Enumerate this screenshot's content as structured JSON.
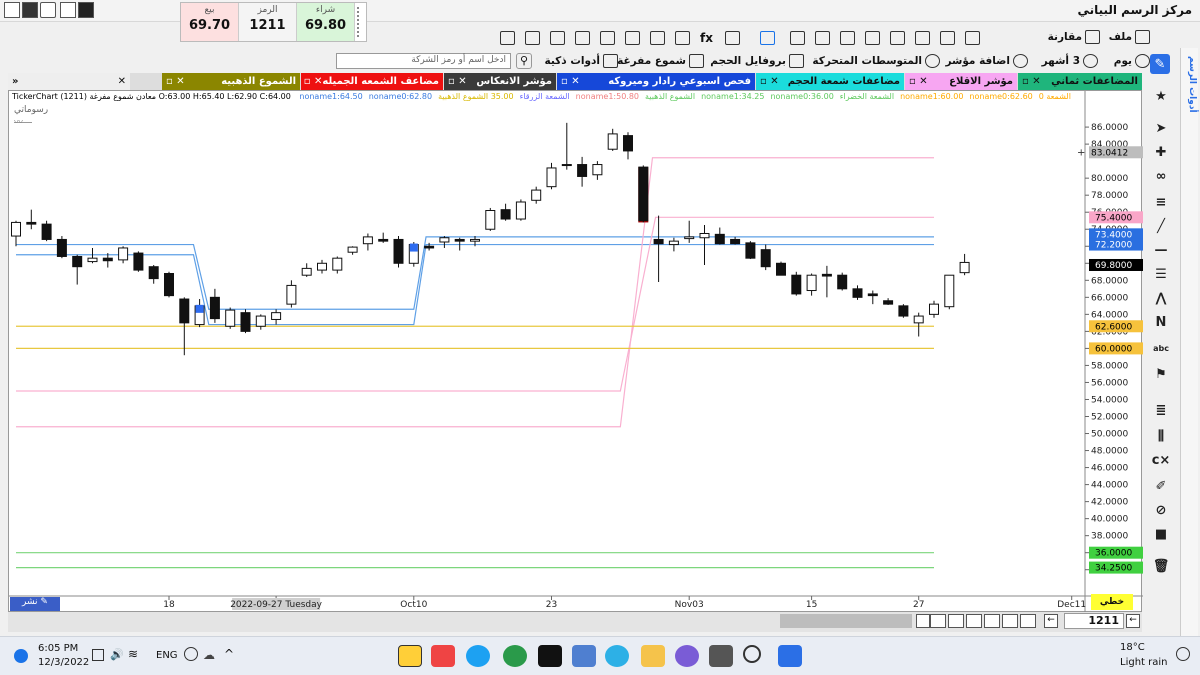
{
  "app": {
    "title": "مركز الرسم البياني"
  },
  "quote": {
    "sell_label": "بيع",
    "sell_value": "69.70",
    "symbol_label": "الرمز",
    "symbol_value": "1211",
    "buy_label": "شراء",
    "buy_value": "69.80"
  },
  "toolbar1": {
    "file": "ملف",
    "compare": "مقارنة"
  },
  "toolbar2": {
    "day": "يوم",
    "months": "3 أشهر",
    "add_indicator": "اضافة مؤشر",
    "moving_avgs": "المتوسطات المتحركة",
    "volume_profile": "بروفايل الحجم",
    "hollow_candles": "شموع مفرغة",
    "smart_tools": "أدوات ذكية",
    "search_placeholder": "ادخل اسم أو رمز الشركة"
  },
  "tabs": [
    {
      "label": "المضاعفات ثماني",
      "color": "#1fb57c"
    },
    {
      "label": "مؤشر الاقلاع",
      "color": "#f7a6f2"
    },
    {
      "label": "مضاعفات شمعة الحجم",
      "color": "#1bdcdc"
    },
    {
      "label": "فحص اسبوعي رادار وميروكه",
      "color": "#1648d9"
    },
    {
      "label": "مؤشر الانعكاس",
      "color": "#3a3a3a"
    },
    {
      "label": "مضاعف الشمعه الجميله",
      "color": "#e11"
    },
    {
      "label": "الشموع الذهبيه",
      "color": "#8b8600"
    }
  ],
  "legend": {
    "ohlc": "TickerChart (1211) معادن شموع مفرغة O:63.00 H:65.40 L:62.90 C:64.00",
    "items": [
      {
        "text": "noname1:64.50",
        "color": "#3a7be0"
      },
      {
        "text": "noname0:62.80",
        "color": "#3a7be0"
      },
      {
        "text": "الشمعة الزرقاء",
        "color": "#6b6bff"
      },
      {
        "text": "35.00 الشموع الذهبية",
        "color": "#d8b800"
      },
      {
        "text": "noname1:50.80",
        "color": "#f08080"
      },
      {
        "text": "الشموع الذهبية",
        "color": "#5ec95e"
      },
      {
        "text": "noname1:34.25",
        "color": "#5ec95e"
      },
      {
        "text": "noname0:36.00",
        "color": "#5ec95e"
      },
      {
        "text": "الشمعة الخضراء",
        "color": "#5ec95e"
      },
      {
        "text": "noname1:60.00",
        "color": "#ffaa00"
      },
      {
        "text": "noname0:62.60",
        "color": "#ffaa00"
      },
      {
        "text": "الشمعة 0",
        "color": "#ffaa00"
      }
    ]
  },
  "drawings_label": "رسوماتي",
  "draw_button": "نشر",
  "goto_button": "خطي",
  "symbol_box": "1211",
  "side_panel_label": "أدوات الرسم",
  "price_axis": {
    "ticks": [
      "86.0000",
      "84.0000",
      "80.0000",
      "78.0000",
      "76.0000",
      "74.0000",
      "72.0000",
      "70.0000",
      "68.0000",
      "66.0000",
      "64.0000",
      "62.0000",
      "60.0000",
      "58.0000",
      "56.0000",
      "54.0000",
      "52.0000",
      "50.0000",
      "48.0000",
      "46.0000",
      "44.0000",
      "42.0000",
      "40.0000",
      "38.0000",
      "36.0000",
      "34.0000"
    ],
    "current": "83.0412",
    "badges": [
      {
        "label": "75.4000",
        "value": 75.4,
        "bg": "#f9a6c8",
        "fg": "#000"
      },
      {
        "label": "73.4000",
        "value": 73.4,
        "bg": "#2a6fe0",
        "fg": "#fff"
      },
      {
        "label": "72.2000",
        "value": 72.2,
        "bg": "#2a6fe0",
        "fg": "#fff"
      },
      {
        "label": "69.8000",
        "value": 69.8,
        "bg": "#000",
        "fg": "#fff"
      },
      {
        "label": "62.6000",
        "value": 62.6,
        "bg": "#f6c23c",
        "fg": "#000"
      },
      {
        "label": "60.0000",
        "value": 60.0,
        "bg": "#f6c23c",
        "fg": "#000"
      },
      {
        "label": "36.0000",
        "value": 36.0,
        "bg": "#40d040",
        "fg": "#000"
      },
      {
        "label": "34.2500",
        "value": 34.25,
        "bg": "#40d040",
        "fg": "#000"
      }
    ]
  },
  "time_axis": {
    "ticks": [
      {
        "label": "18",
        "index": 10
      },
      {
        "label": "2022-09-27 Tuesday",
        "index": 17,
        "highlight": true
      },
      {
        "label": "Oct10",
        "index": 26
      },
      {
        "label": "23",
        "index": 35
      },
      {
        "label": "Nov03",
        "index": 44
      },
      {
        "label": "15",
        "index": 52
      },
      {
        "label": "27",
        "index": 59
      },
      {
        "label": "Dec11",
        "index": 69
      }
    ]
  },
  "chart_data": {
    "type": "candlestick",
    "ylim": [
      31.5,
      89.3
    ],
    "candles": [
      {
        "o": 73.2,
        "h": 75.0,
        "l": 72.0,
        "c": 74.8
      },
      {
        "o": 74.8,
        "h": 76.3,
        "l": 74.0,
        "c": 74.6
      },
      {
        "o": 74.6,
        "h": 75.0,
        "l": 72.6,
        "c": 72.8
      },
      {
        "o": 72.8,
        "h": 73.2,
        "l": 70.6,
        "c": 70.8
      },
      {
        "o": 70.8,
        "h": 71.0,
        "l": 67.5,
        "c": 69.6
      },
      {
        "o": 70.2,
        "h": 71.8,
        "l": 70.0,
        "c": 70.6
      },
      {
        "o": 70.6,
        "h": 71.2,
        "l": 69.5,
        "c": 70.3
      },
      {
        "o": 70.4,
        "h": 72.0,
        "l": 70.0,
        "c": 71.8
      },
      {
        "o": 71.2,
        "h": 71.4,
        "l": 69.0,
        "c": 69.2
      },
      {
        "o": 69.6,
        "h": 69.8,
        "l": 67.6,
        "c": 68.2
      },
      {
        "o": 68.8,
        "h": 69.0,
        "l": 66.0,
        "c": 66.2
      },
      {
        "o": 65.8,
        "h": 66.0,
        "l": 59.2,
        "c": 63.0
      },
      {
        "o": 62.8,
        "h": 65.8,
        "l": 62.5,
        "c": 65.0
      },
      {
        "o": 66.0,
        "h": 67.0,
        "l": 63.0,
        "c": 63.5
      },
      {
        "o": 62.6,
        "h": 64.8,
        "l": 62.3,
        "c": 64.5
      },
      {
        "o": 64.2,
        "h": 64.6,
        "l": 61.8,
        "c": 62.0
      },
      {
        "o": 62.6,
        "h": 64.0,
        "l": 62.2,
        "c": 63.8
      },
      {
        "o": 63.4,
        "h": 64.6,
        "l": 62.8,
        "c": 64.2
      },
      {
        "o": 65.2,
        "h": 68.0,
        "l": 64.8,
        "c": 67.4
      },
      {
        "o": 68.6,
        "h": 70.0,
        "l": 68.4,
        "c": 69.4
      },
      {
        "o": 69.2,
        "h": 70.4,
        "l": 68.8,
        "c": 70.0
      },
      {
        "o": 69.2,
        "h": 70.8,
        "l": 68.8,
        "c": 70.6
      },
      {
        "o": 71.3,
        "h": 72.0,
        "l": 71.0,
        "c": 71.9
      },
      {
        "o": 72.3,
        "h": 73.5,
        "l": 71.5,
        "c": 73.1
      },
      {
        "o": 72.8,
        "h": 73.6,
        "l": 72.4,
        "c": 72.6
      },
      {
        "o": 72.8,
        "h": 73.2,
        "l": 69.5,
        "c": 70.0
      },
      {
        "o": 70.0,
        "h": 72.5,
        "l": 69.6,
        "c": 72.2
      },
      {
        "o": 72.0,
        "h": 72.4,
        "l": 71.5,
        "c": 71.8
      },
      {
        "o": 72.5,
        "h": 73.2,
        "l": 71.8,
        "c": 73.0
      },
      {
        "o": 72.8,
        "h": 73.0,
        "l": 71.5,
        "c": 72.6
      },
      {
        "o": 72.6,
        "h": 73.2,
        "l": 72.0,
        "c": 72.8
      },
      {
        "o": 74.0,
        "h": 76.5,
        "l": 73.8,
        "c": 76.2
      },
      {
        "o": 76.3,
        "h": 77.0,
        "l": 75.0,
        "c": 75.2
      },
      {
        "o": 75.2,
        "h": 77.5,
        "l": 75.0,
        "c": 77.2
      },
      {
        "o": 77.4,
        "h": 79.0,
        "l": 77.0,
        "c": 78.6
      },
      {
        "o": 79.0,
        "h": 81.8,
        "l": 78.7,
        "c": 81.2
      },
      {
        "o": 81.5,
        "h": 86.5,
        "l": 81.0,
        "c": 81.6
      },
      {
        "o": 81.6,
        "h": 82.5,
        "l": 79.0,
        "c": 80.2
      },
      {
        "o": 80.4,
        "h": 82.0,
        "l": 79.8,
        "c": 81.6
      },
      {
        "o": 83.4,
        "h": 85.8,
        "l": 83.2,
        "c": 85.2
      },
      {
        "o": 85.0,
        "h": 85.4,
        "l": 82.2,
        "c": 83.2
      },
      {
        "o": 81.3,
        "h": 81.5,
        "l": 74.8,
        "c": 75.0
      },
      {
        "o": 72.8,
        "h": 75.6,
        "l": 67.8,
        "c": 72.3
      },
      {
        "o": 72.2,
        "h": 73.0,
        "l": 71.4,
        "c": 72.6
      },
      {
        "o": 72.9,
        "h": 75.0,
        "l": 72.4,
        "c": 73.1
      },
      {
        "o": 73.0,
        "h": 74.5,
        "l": 69.8,
        "c": 73.5
      },
      {
        "o": 73.4,
        "h": 74.2,
        "l": 72.2,
        "c": 72.3
      },
      {
        "o": 72.8,
        "h": 73.1,
        "l": 72.2,
        "c": 72.3
      },
      {
        "o": 72.4,
        "h": 72.6,
        "l": 70.5,
        "c": 70.6
      },
      {
        "o": 71.6,
        "h": 72.2,
        "l": 69.2,
        "c": 69.6
      },
      {
        "o": 70.0,
        "h": 70.2,
        "l": 68.6,
        "c": 68.6
      },
      {
        "o": 68.6,
        "h": 69.0,
        "l": 66.2,
        "c": 66.4
      },
      {
        "o": 66.8,
        "h": 68.8,
        "l": 66.2,
        "c": 68.6
      },
      {
        "o": 68.7,
        "h": 69.7,
        "l": 66.0,
        "c": 68.5
      },
      {
        "o": 68.6,
        "h": 68.9,
        "l": 66.8,
        "c": 67.0
      },
      {
        "o": 67.0,
        "h": 67.4,
        "l": 65.7,
        "c": 66.0
      },
      {
        "o": 66.4,
        "h": 66.8,
        "l": 65.2,
        "c": 66.2
      },
      {
        "o": 65.6,
        "h": 65.9,
        "l": 65.1,
        "c": 65.2
      },
      {
        "o": 65.0,
        "h": 65.2,
        "l": 63.6,
        "c": 63.8
      },
      {
        "o": 63.0,
        "h": 64.2,
        "l": 61.4,
        "c": 63.8
      },
      {
        "o": 64.0,
        "h": 65.6,
        "l": 63.6,
        "c": 65.2
      },
      {
        "o": 64.9,
        "h": 68.6,
        "l": 64.6,
        "c": 68.6
      },
      {
        "o": 68.9,
        "h": 71.1,
        "l": 68.6,
        "c": 70.1
      }
    ],
    "lines": [
      {
        "name": "",
        "color": "#5fa0e6",
        "points": [
          [
            0,
            72.2
          ],
          [
            11.6,
            72.2
          ],
          [
            12.6,
            64.6
          ],
          [
            26.0,
            64.6
          ],
          [
            26.8,
            73.1
          ],
          [
            60,
            73.1
          ]
        ]
      },
      {
        "name": "",
        "color": "#5fa0e6",
        "points": [
          [
            0,
            71.0
          ],
          [
            11.6,
            71.0
          ],
          [
            12.6,
            62.8
          ],
          [
            26.0,
            62.8
          ],
          [
            26.8,
            72.2
          ],
          [
            60,
            72.2
          ]
        ]
      },
      {
        "name": "",
        "color": "#f9b0d0",
        "points": [
          [
            0,
            55.0
          ],
          [
            39.5,
            55.0
          ],
          [
            41.8,
            75.4
          ],
          [
            60,
            75.4
          ]
        ]
      },
      {
        "name": "",
        "color": "#f9b0d0",
        "points": [
          [
            0,
            50.8
          ],
          [
            39.5,
            50.8
          ],
          [
            41.6,
            82.4
          ],
          [
            60,
            82.4
          ]
        ]
      },
      {
        "name": "",
        "color": "#e8c840",
        "points": [
          [
            0,
            62.6
          ],
          [
            60,
            62.6
          ]
        ]
      },
      {
        "name": "",
        "color": "#e8c840",
        "points": [
          [
            0,
            60.0
          ],
          [
            60,
            60.0
          ]
        ]
      },
      {
        "name": "",
        "color": "#7cd67c",
        "points": [
          [
            0,
            36.0
          ],
          [
            60,
            36.0
          ]
        ]
      },
      {
        "name": "",
        "color": "#7cd67c",
        "points": [
          [
            0,
            34.25
          ],
          [
            60,
            34.25
          ]
        ]
      }
    ],
    "blue_markers": [
      12,
      26
    ],
    "red_bar": {
      "index": 41,
      "top": 81.3,
      "bottom": 74.8
    }
  },
  "taskbar": {
    "time": "6:05 PM",
    "date": "12/3/2022",
    "lang": "ENG",
    "temp": "18°C",
    "weather": "Light rain"
  }
}
